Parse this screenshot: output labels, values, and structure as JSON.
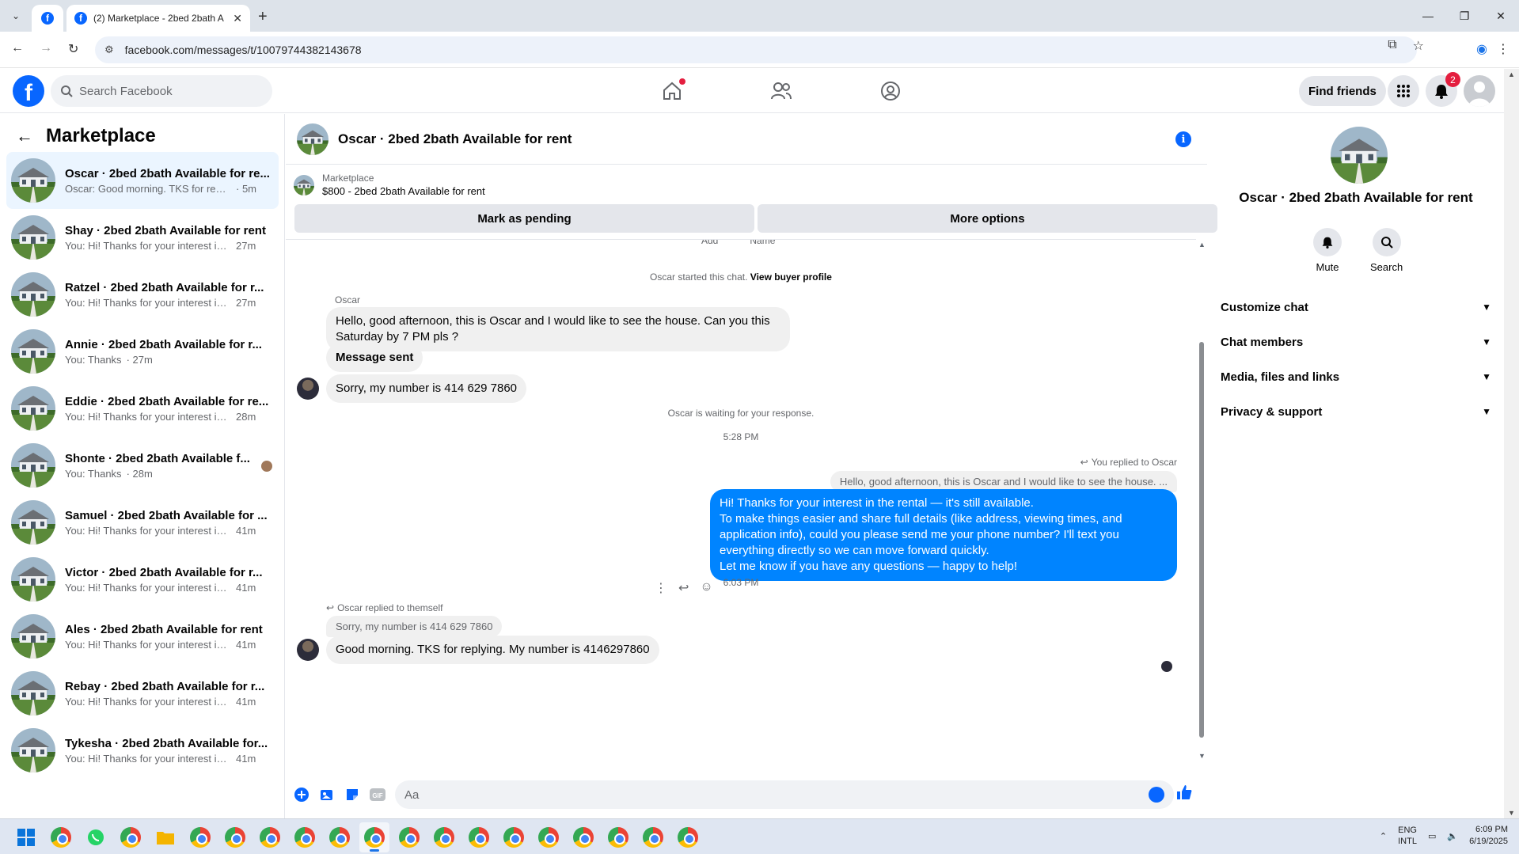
{
  "browser": {
    "tab_title": "(2) Marketplace - 2bed 2bath A",
    "url": "facebook.com/messages/t/10079744382143678"
  },
  "fb": {
    "search_placeholder": "Search Facebook",
    "find_friends": "Find friends",
    "notifications_count": "2"
  },
  "sidebar": {
    "title": "Marketplace",
    "conversations": [
      {
        "name": "Oscar · 2bed 2bath Available for re...",
        "snippet": "Oscar: Good morning. TKS for replyin...",
        "time": "· 5m",
        "active": true
      },
      {
        "name": "Shay · 2bed 2bath Available for rent",
        "snippet": "You: Hi! Thanks for your interest in t...",
        "time": "27m"
      },
      {
        "name": "Ratzel · 2bed 2bath Available for r...",
        "snippet": "You: Hi! Thanks for your interest in t...",
        "time": "27m"
      },
      {
        "name": "Annie · 2bed 2bath Available for r...",
        "snippet": "You: Thanks",
        "time": "· 27m"
      },
      {
        "name": "Eddie · 2bed 2bath Available for re...",
        "snippet": "You: Hi! Thanks for your interest in t...",
        "time": "28m"
      },
      {
        "name": "Shonte · 2bed 2bath Available f...",
        "snippet": "You: Thanks",
        "time": "· 28m"
      },
      {
        "name": "Samuel · 2bed 2bath Available for ...",
        "snippet": "You: Hi! Thanks for your interest in t...",
        "time": "41m"
      },
      {
        "name": "Victor · 2bed 2bath Available for r...",
        "snippet": "You: Hi! Thanks for your interest in t...",
        "time": "41m"
      },
      {
        "name": "Ales · 2bed 2bath Available for rent",
        "snippet": "You: Hi! Thanks for your interest in t...",
        "time": "41m"
      },
      {
        "name": "Rebay · 2bed 2bath Available for r...",
        "snippet": "You: Hi! Thanks for your interest in t...",
        "time": "41m"
      },
      {
        "name": "Tykesha · 2bed 2bath Available for...",
        "snippet": "You: Hi! Thanks for your interest in t...",
        "time": "41m"
      }
    ]
  },
  "chat": {
    "title": "Oscar · 2bed 2bath Available for rent",
    "listing_label": "Marketplace",
    "listing_title": "$800 - 2bed 2bath Available for rent",
    "mark_pending": "Mark as pending",
    "more_options": "More options",
    "cut_label_1": "Add",
    "cut_label_2": "Name",
    "started_text": "Oscar started this chat.",
    "view_buyer": "View buyer profile",
    "sender_name": "Oscar",
    "msg1": "Hello, good afternoon, this is Oscar and I would like to see the house. Can you this Saturday by 7 PM pls ?",
    "msg2": "Message sent",
    "msg3": "Sorry, my number is 414 629 7860",
    "waiting": "Oscar is waiting for your response.",
    "time1": "5:28 PM",
    "you_replied": "You replied to Oscar",
    "quoted1": "Hello, good afternoon, this is Oscar and I would like to see the house. ...",
    "out_line1": "Hi! Thanks for your interest in the rental — it's still available.",
    "out_line2": "To make things easier and share full details (like address, viewing times, and application info), could you please send me your phone number? I'll text you everything directly so we can move forward quickly.",
    "out_line3": "Let me know if you have any questions — happy to help!",
    "time2": "6:03 PM",
    "oscar_replied": "Oscar replied to themself",
    "quoted2": "Sorry, my number is 414 629 7860",
    "msg4": "Good morning. TKS for replying. My number is 4146297860",
    "composer_placeholder": "Aa"
  },
  "rpanel": {
    "title": "Oscar · 2bed 2bath Available for rent",
    "mute": "Mute",
    "search": "Search",
    "sections": [
      "Customize chat",
      "Chat members",
      "Media, files and links",
      "Privacy & support"
    ]
  },
  "taskbar": {
    "lang1": "ENG",
    "lang2": "INTL",
    "time": "6:09 PM",
    "date": "6/19/2025"
  }
}
